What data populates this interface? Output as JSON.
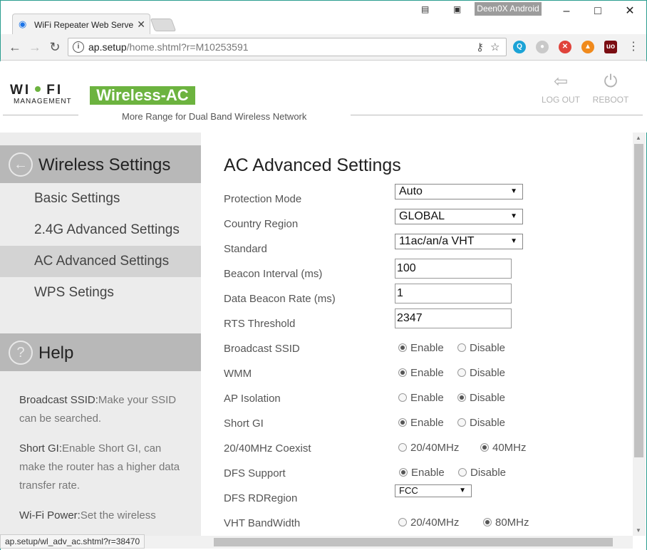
{
  "browser": {
    "tab_title": "WiFi Repeater Web Serve",
    "profile_name": "Deen0X Android",
    "url_host": "ap.setup",
    "url_path": "/home.shtml?r=M10253591",
    "status_url": "ap.setup/wl_adv_ac.shtml?r=38470"
  },
  "header": {
    "logo_wi": "WI",
    "logo_fi": "FI",
    "logo_sub": "MANAGEMENT",
    "brand": "Wireless-AC",
    "tagline": "More Range for Dual Band Wireless Network",
    "logout_label": "LOG OUT",
    "reboot_label": "REBOOT"
  },
  "sidebar": {
    "section_title": "Wireless Settings",
    "items": [
      {
        "label": "Basic Settings"
      },
      {
        "label": "2.4G Advanced Settings"
      },
      {
        "label": "AC Advanced Settings"
      },
      {
        "label": "WPS Setings"
      }
    ],
    "active_index": 2,
    "help_title": "Help",
    "help": [
      {
        "term": "Broadcast SSID:",
        "text": "Make your SSID can be searched."
      },
      {
        "term": "Short GI:",
        "text": "Enable Short GI, can make the router has a higher data transfer rate."
      },
      {
        "term": "Wi-Fi Power:",
        "text": "Set the wireless"
      }
    ]
  },
  "main": {
    "title": "AC Advanced Settings",
    "protection_mode": {
      "label": "Protection Mode",
      "value": "Auto"
    },
    "country_region": {
      "label": "Country Region",
      "value": "GLOBAL"
    },
    "standard": {
      "label": "Standard",
      "value": "11ac/an/a VHT"
    },
    "beacon_interval": {
      "label": "Beacon Interval (ms)",
      "value": "100"
    },
    "data_beacon_rate": {
      "label": "Data Beacon Rate (ms)",
      "value": "1"
    },
    "rts_threshold": {
      "label": "RTS Threshold",
      "value": "2347"
    },
    "broadcast_ssid": {
      "label": "Broadcast SSID",
      "opt1": "Enable",
      "opt2": "Disable",
      "selected": "Enable"
    },
    "wmm": {
      "label": "WMM",
      "opt1": "Enable",
      "opt2": "Disable",
      "selected": "Enable"
    },
    "ap_isolation": {
      "label": "AP Isolation",
      "opt1": "Enable",
      "opt2": "Disable",
      "selected": "Disable"
    },
    "short_gi": {
      "label": "Short GI",
      "opt1": "Enable",
      "opt2": "Disable",
      "selected": "Enable"
    },
    "coexist": {
      "label": "20/40MHz Coexist",
      "opt1": "20/40MHz",
      "opt2": "40MHz",
      "selected": "40MHz"
    },
    "dfs_support": {
      "label": "DFS Support",
      "opt1": "Enable",
      "opt2": "Disable",
      "selected": "Enable"
    },
    "dfs_rdregion": {
      "label": "DFS RDRegion",
      "value": "FCC"
    },
    "vht_bandwidth": {
      "label": "VHT BandWidth",
      "opt1": "20/40MHz",
      "opt2": "80MHz",
      "selected": "80MHz"
    }
  },
  "colors": {
    "brand_green": "#6cb33f",
    "sidebar_header": "#b8b8b8",
    "window_border": "#2b9d8f"
  }
}
